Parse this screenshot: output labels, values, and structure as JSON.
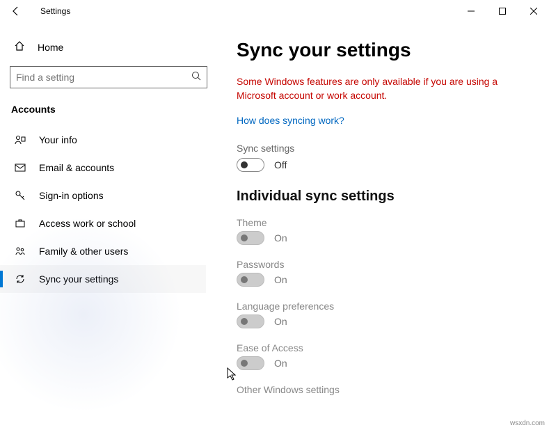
{
  "window": {
    "title": "Settings"
  },
  "sidebar": {
    "home": "Home",
    "search_placeholder": "Find a setting",
    "category": "Accounts",
    "items": [
      {
        "label": "Your info"
      },
      {
        "label": "Email & accounts"
      },
      {
        "label": "Sign-in options"
      },
      {
        "label": "Access work or school"
      },
      {
        "label": "Family & other users"
      },
      {
        "label": "Sync your settings"
      }
    ]
  },
  "main": {
    "title": "Sync your settings",
    "warning": "Some Windows features are only available if you are using a Microsoft account or work account.",
    "link": "How does syncing work?",
    "sync_label": "Sync settings",
    "sync_state": "Off",
    "section_title": "Individual sync settings",
    "individual": [
      {
        "label": "Theme",
        "state": "On"
      },
      {
        "label": "Passwords",
        "state": "On"
      },
      {
        "label": "Language preferences",
        "state": "On"
      },
      {
        "label": "Ease of Access",
        "state": "On"
      },
      {
        "label": "Other Windows settings",
        "state": ""
      }
    ]
  },
  "watermark": "wsxdn.com"
}
